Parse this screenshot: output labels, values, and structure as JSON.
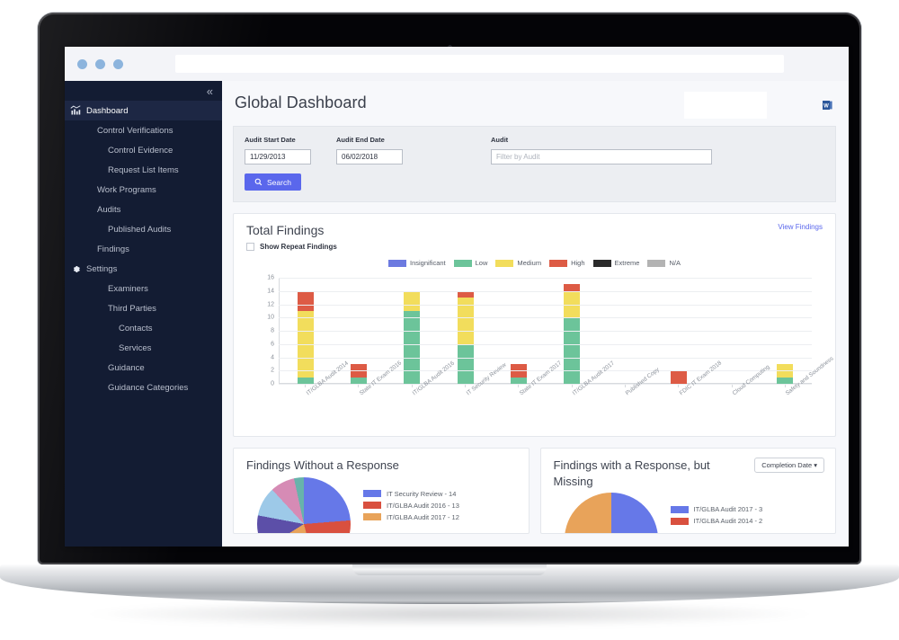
{
  "browser": {
    "dots": [
      "dot-1",
      "dot-2",
      "dot-3"
    ],
    "url_value": ""
  },
  "sidebar": {
    "collapse_icon": "chevron-double-left-icon",
    "items": [
      {
        "label": "Dashboard",
        "level": 0,
        "icon": "analytics-bars-icon",
        "active": true
      },
      {
        "label": "Control Verifications",
        "level": 1,
        "icon": "",
        "active": false
      },
      {
        "label": "Control Evidence",
        "level": 2,
        "icon": "",
        "active": false
      },
      {
        "label": "Request List Items",
        "level": 2,
        "icon": "",
        "active": false
      },
      {
        "label": "Work Programs",
        "level": 1,
        "icon": "",
        "active": false
      },
      {
        "label": "Audits",
        "level": 1,
        "icon": "",
        "active": false
      },
      {
        "label": "Published Audits",
        "level": 2,
        "icon": "",
        "active": false
      },
      {
        "label": "Findings",
        "level": 1,
        "icon": "",
        "active": false
      },
      {
        "label": "Settings",
        "level": 0,
        "icon": "gear-icon",
        "active": false
      },
      {
        "label": "Examiners",
        "level": 2,
        "icon": "",
        "active": false
      },
      {
        "label": "Third Parties",
        "level": 2,
        "icon": "",
        "active": false
      },
      {
        "label": "Contacts",
        "level": 3,
        "icon": "",
        "active": false
      },
      {
        "label": "Services",
        "level": 3,
        "icon": "",
        "active": false
      },
      {
        "label": "Guidance",
        "level": 2,
        "icon": "",
        "active": false
      },
      {
        "label": "Guidance Categories",
        "level": 2,
        "icon": "",
        "active": false
      }
    ]
  },
  "header": {
    "title": "Global Dashboard",
    "export_icon": "word-document-icon"
  },
  "filters": {
    "start_label": "Audit Start Date",
    "start_value": "11/29/2013",
    "end_label": "Audit End Date",
    "end_value": "06/02/2018",
    "audit_label": "Audit",
    "audit_value": "",
    "audit_placeholder": "Filter by Audit",
    "search_label": "Search",
    "search_icon": "magnifier-icon"
  },
  "total_findings": {
    "title": "Total Findings",
    "view_link": "View Findings",
    "checkbox_label": "Show Repeat Findings",
    "checkbox_checked": false
  },
  "chart_data": {
    "type": "bar",
    "stacked": true,
    "title": "Total Findings",
    "xlabel": "",
    "ylabel": "",
    "ylim": [
      0,
      16
    ],
    "yticks": [
      0,
      2,
      4,
      6,
      8,
      10,
      12,
      14,
      16
    ],
    "grid": true,
    "legend_position": "top-center",
    "categories": [
      "IT/GLBA Audit 2014",
      "State IT Exam 2016",
      "IT/GLBA Audit 2016",
      "IT Security Review",
      "State IT Exam 2017",
      "IT/GLBA Audit 2017",
      "Published Copy",
      "FDIC IT Exam 2018",
      "Cloud Computing",
      "Safety and Soundness"
    ],
    "series": [
      {
        "name": "Insignificant",
        "color": "#6c7ae0",
        "values": [
          0,
          0,
          0,
          0,
          0,
          0,
          0,
          0,
          0,
          0
        ]
      },
      {
        "name": "Low",
        "color": "#6cc49a",
        "values": [
          1,
          1,
          11,
          6,
          1,
          10,
          0,
          0,
          0,
          1
        ]
      },
      {
        "name": "Medium",
        "color": "#f2dd5c",
        "values": [
          10,
          0,
          3,
          7,
          0,
          4,
          0,
          0,
          0,
          2
        ]
      },
      {
        "name": "High",
        "color": "#dd5b45",
        "values": [
          3,
          2,
          0,
          1,
          2,
          1,
          0,
          2,
          0,
          0
        ]
      },
      {
        "name": "Extreme",
        "color": "#2b2b2b",
        "values": [
          0,
          0,
          0,
          0,
          0,
          0,
          0,
          0,
          0,
          0
        ]
      },
      {
        "name": "N/A",
        "color": "#b3b3b3",
        "values": [
          0,
          0,
          0,
          0,
          0,
          0,
          0,
          0,
          0,
          0
        ]
      }
    ],
    "totals": [
      14,
      3,
      14,
      14,
      3,
      15,
      0,
      2,
      0,
      3
    ]
  },
  "findings_without_response": {
    "title": "Findings Without a Response",
    "chart": {
      "type": "pie",
      "slices": [
        {
          "label": "IT Security Review - 14",
          "value": 14,
          "color": "#6678e8"
        },
        {
          "label": "IT/GLBA Audit 2016 - 13",
          "value": 13,
          "color": "#d9503f"
        },
        {
          "label": "IT/GLBA Audit 2017 - 12",
          "value": 12,
          "color": "#e8a35a"
        },
        {
          "label": "slice-4",
          "value": 7,
          "color": "#5c4fa8"
        },
        {
          "label": "slice-5",
          "value": 6,
          "color": "#9dc9e8"
        },
        {
          "label": "slice-6",
          "value": 5,
          "color": "#d68bb5"
        },
        {
          "label": "slice-7",
          "value": 2,
          "color": "#67b3ab"
        }
      ]
    },
    "legend": [
      {
        "label": "IT Security Review - 14",
        "color": "#6678e8"
      },
      {
        "label": "IT/GLBA Audit 2016 - 13",
        "color": "#d9503f"
      },
      {
        "label": "IT/GLBA Audit 2017 - 12",
        "color": "#e8a35a"
      }
    ]
  },
  "findings_with_response": {
    "title": "Findings with a Response, but Missing",
    "dropdown_label": "Completion Date",
    "dropdown_icon": "caret-down-icon",
    "chart": {
      "type": "pie",
      "slices": [
        {
          "label": "IT/GLBA Audit 2017 - 3",
          "value": 3,
          "color": "#6678e8"
        },
        {
          "label": "IT/GLBA Audit 2014 - 2",
          "value": 2,
          "color": "#e8a35a"
        }
      ]
    },
    "legend": [
      {
        "label": "IT/GLBA Audit 2017 - 3",
        "color": "#6678e8"
      },
      {
        "label": "IT/GLBA Audit 2014 - 2",
        "color": "#d9503f"
      }
    ]
  }
}
